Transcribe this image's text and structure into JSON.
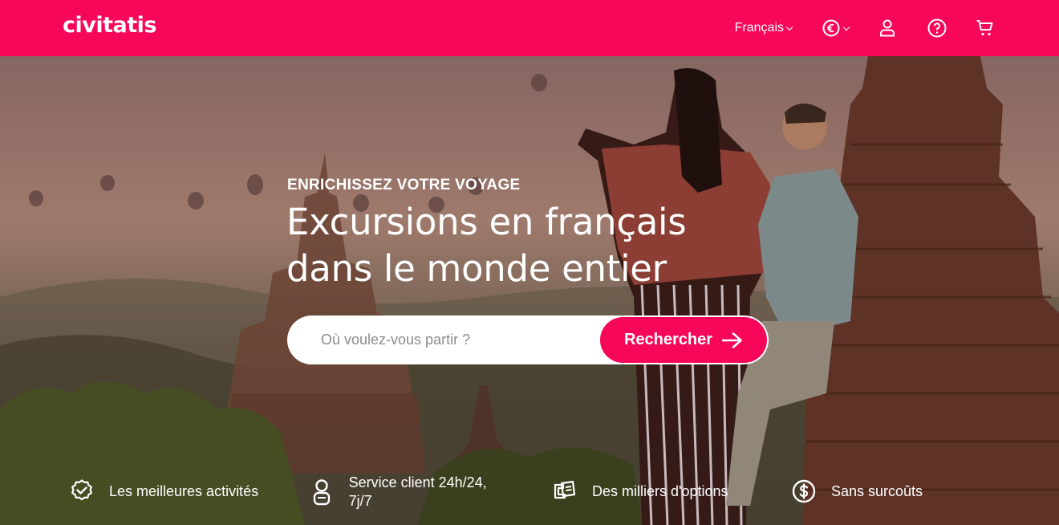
{
  "header": {
    "logo": "civitatis",
    "language": "Français",
    "currency_icon": "euro-icon",
    "icons": [
      "user-icon",
      "help-icon",
      "cart-icon"
    ],
    "brand_color": "#f70759"
  },
  "hero": {
    "eyebrow": "ENRICHISSEZ VOTRE VOYAGE",
    "title_line1": "Excursions en français",
    "title_line2": "dans le monde entier",
    "search_placeholder": "Où voulez-vous partir ?",
    "search_button": "Rechercher"
  },
  "features": [
    {
      "icon": "badge-check-icon",
      "label": "Les meilleures activités"
    },
    {
      "icon": "support-agent-icon",
      "label": "Service client 24h/24, 7j/7"
    },
    {
      "icon": "tickets-icon",
      "label": "Des milliers d'options"
    },
    {
      "icon": "dollar-coin-icon",
      "label": "Sans surcoûts"
    }
  ]
}
